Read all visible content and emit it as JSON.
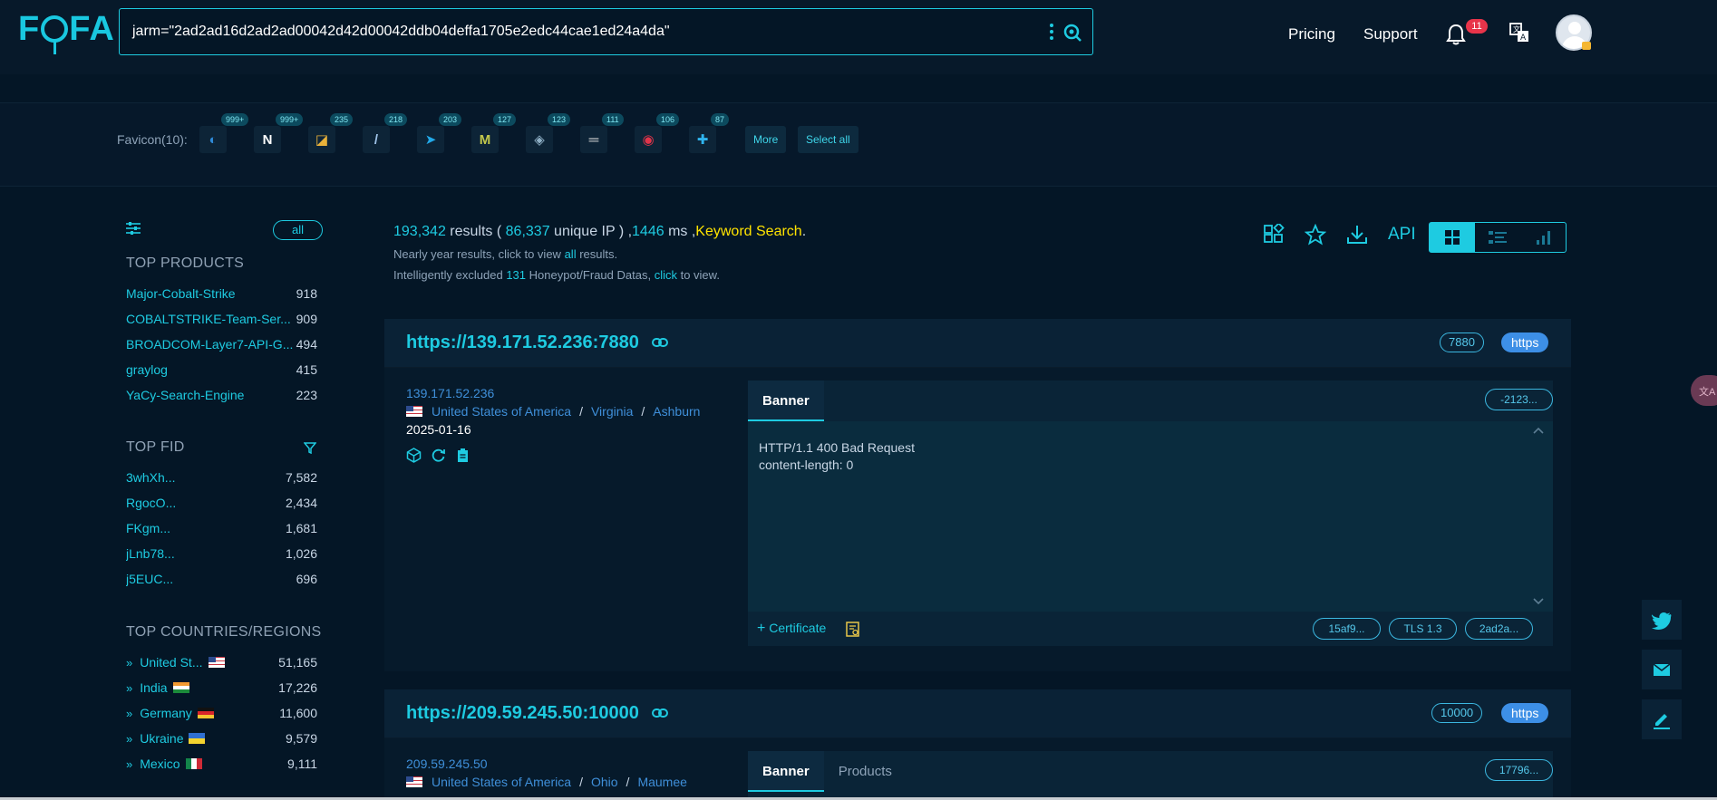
{
  "header": {
    "logo": "FOFA",
    "search_query": "jarm=\"2ad2ad16d2ad2ad00042d42d00042ddb04deffa1705e2edc44cae1ed24a4da\"",
    "nav": [
      "Pricing",
      "Support"
    ],
    "notification_count": "11",
    "icons": [
      "kebab-icon",
      "search-icon",
      "bell-icon",
      "translate-icon",
      "avatar"
    ]
  },
  "favicons": {
    "label": "Favicon(10):",
    "items": [
      {
        "count": "999+",
        "glyph": "◐",
        "color": "#2f8ad8"
      },
      {
        "count": "999+",
        "glyph": "N",
        "color": "#ffffff"
      },
      {
        "count": "235",
        "glyph": "◪",
        "color": "#e8b13a"
      },
      {
        "count": "218",
        "glyph": "/",
        "color": "#9fc3e8"
      },
      {
        "count": "203",
        "glyph": "➤",
        "color": "#22a9e8"
      },
      {
        "count": "127",
        "glyph": "M",
        "color": "#c3c84b"
      },
      {
        "count": "123",
        "glyph": "◈",
        "color": "#8fb0c6"
      },
      {
        "count": "111",
        "glyph": "═",
        "color": "#d7d7d7"
      },
      {
        "count": "106",
        "glyph": "◉",
        "color": "#e0344a"
      },
      {
        "count": "87",
        "glyph": "✚",
        "color": "#2fb4ee"
      }
    ],
    "more": "More",
    "select_all": "Select all"
  },
  "sidebar": {
    "all_label": "all",
    "top_products": {
      "title": "TOP PRODUCTS",
      "rows": [
        {
          "name": "Major-Cobalt-Strike",
          "count": "918"
        },
        {
          "name": "COBALTSTRIKE-Team-Ser...",
          "count": "909"
        },
        {
          "name": "BROADCOM-Layer7-API-G...",
          "count": "494"
        },
        {
          "name": "graylog",
          "count": "415"
        },
        {
          "name": "YaCy-Search-Engine",
          "count": "223"
        }
      ]
    },
    "top_fid": {
      "title": "TOP FID",
      "rows": [
        {
          "name": "3whXh...",
          "count": "7,582"
        },
        {
          "name": "RgocO...",
          "count": "2,434"
        },
        {
          "name": "FKgm...",
          "count": "1,681"
        },
        {
          "name": "jLnb78...",
          "count": "1,026"
        },
        {
          "name": "j5EUC...",
          "count": "696"
        }
      ]
    },
    "top_countries": {
      "title": "TOP COUNTRIES/REGIONS",
      "rows": [
        {
          "name": "United St...",
          "count": "51,165",
          "flag": "us"
        },
        {
          "name": "India",
          "count": "17,226",
          "flag": "in"
        },
        {
          "name": "Germany",
          "count": "11,600",
          "flag": "de"
        },
        {
          "name": "Ukraine",
          "count": "9,579",
          "flag": "ua"
        },
        {
          "name": "Mexico",
          "count": "9,111",
          "flag": "mx"
        }
      ]
    }
  },
  "summary": {
    "total": "193,342",
    "results_label": "results (",
    "unique_ip": "86,337",
    "unique_label": "unique IP ) ,",
    "ms": "1446",
    "ms_label": "ms ,",
    "keyword": "Keyword Search",
    "line2_pre": "Nearly year results, click to view",
    "line2_link": "all",
    "line2_post": "results.",
    "line3_pre": "Intelligently excluded",
    "line3_num": "131",
    "line3_mid": "Honeypot/Fraud Datas,",
    "line3_link": "click",
    "line3_post": "to view.",
    "api": "API"
  },
  "results": [
    {
      "url": "https://139.171.52.236:7880",
      "port": "7880",
      "protocol": "https",
      "ip": "139.171.52.236",
      "country": "United States of America",
      "region": "Virginia",
      "city": "Ashburn",
      "date": "2025-01-16",
      "tabs": [
        "Banner"
      ],
      "hash": "-2123...",
      "banner": "HTTP/1.1 400 Bad Request\ncontent-length: 0",
      "certificate": "Certificate",
      "cert_pills": [
        "15af9...",
        "TLS 1.3",
        "2ad2a..."
      ]
    },
    {
      "url": "https://209.59.245.50:10000",
      "port": "10000",
      "protocol": "https",
      "ip": "209.59.245.50",
      "country": "United States of America",
      "region": "Ohio",
      "city": "Maumee",
      "tabs": [
        "Banner",
        "Products"
      ],
      "hash": "17796..."
    }
  ],
  "floating": [
    "twitter-icon",
    "mail-icon",
    "edit-icon"
  ]
}
